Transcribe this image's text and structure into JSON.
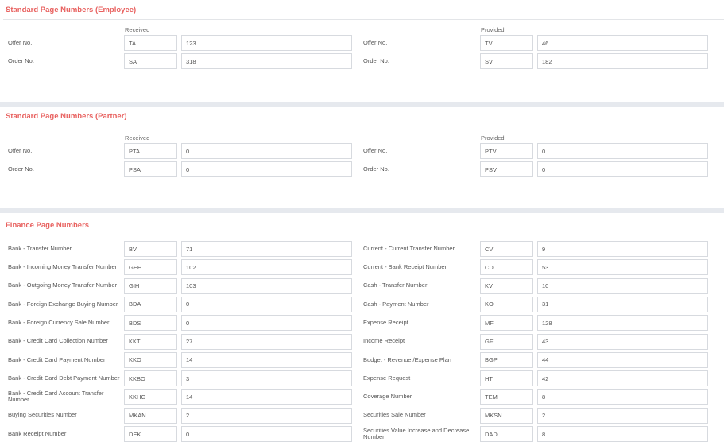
{
  "employee": {
    "title": "Standard Page Numbers (Employee)",
    "received_header": "Received",
    "provided_header": "Provided",
    "rows": [
      {
        "left_label": "Offer No.",
        "left_code": "TA",
        "left_value": "123",
        "right_label": "Offer No.",
        "right_code": "TV",
        "right_value": "46"
      },
      {
        "left_label": "Order No.",
        "left_code": "SA",
        "left_value": "318",
        "right_label": "Order No.",
        "right_code": "SV",
        "right_value": "182"
      }
    ]
  },
  "partner": {
    "title": "Standard Page Numbers (Partner)",
    "received_header": "Received",
    "provided_header": "Provided",
    "rows": [
      {
        "left_label": "Offer No.",
        "left_code": "PTA",
        "left_value": "0",
        "right_label": "Offer No.",
        "right_code": "PTV",
        "right_value": "0"
      },
      {
        "left_label": "Order No.",
        "left_code": "PSA",
        "left_value": "0",
        "right_label": "Order No.",
        "right_code": "PSV",
        "right_value": "0"
      }
    ]
  },
  "finance": {
    "title": "Finance Page Numbers",
    "rows": [
      {
        "left_label": "Bank - Transfer Number",
        "left_code": "BV",
        "left_value": "71",
        "right_label": "Current - Current Transfer Number",
        "right_code": "CV",
        "right_value": "9"
      },
      {
        "left_label": "Bank - Incoming Money Transfer Number",
        "left_code": "GEH",
        "left_value": "102",
        "right_label": "Current - Bank Receipt Number",
        "right_code": "CD",
        "right_value": "53"
      },
      {
        "left_label": "Bank - Outgoing Money Transfer Number",
        "left_code": "GIH",
        "left_value": "103",
        "right_label": "Cash - Transfer Number",
        "right_code": "KV",
        "right_value": "10"
      },
      {
        "left_label": "Bank - Foreign Exchange Buying Number",
        "left_code": "BDA",
        "left_value": "0",
        "right_label": "Cash - Payment Number",
        "right_code": "KO",
        "right_value": "31"
      },
      {
        "left_label": "Bank - Foreign Currency Sale Number",
        "left_code": "BDS",
        "left_value": "0",
        "right_label": "Expense Receipt",
        "right_code": "MF",
        "right_value": "128"
      },
      {
        "left_label": "Bank - Credit Card Collection Number",
        "left_code": "KKT",
        "left_value": "27",
        "right_label": "Income Receipt",
        "right_code": "GF",
        "right_value": "43"
      },
      {
        "left_label": "Bank - Credit Card Payment Number",
        "left_code": "KKO",
        "left_value": "14",
        "right_label": "Budget - Revenue /Expense Plan",
        "right_code": "BGP",
        "right_value": "44"
      },
      {
        "left_label": "Bank - Credit Card Debt Payment Number",
        "left_code": "KKBO",
        "left_value": "3",
        "right_label": "Expense Request",
        "right_code": "HT",
        "right_value": "42"
      },
      {
        "left_label": "Bank - Credit Card Account Transfer Number",
        "left_code": "KKHG",
        "left_value": "14",
        "right_label": "Coverage Number",
        "right_code": "TEM",
        "right_value": "8"
      },
      {
        "left_label": "Buying Securities Number",
        "left_code": "MKAN",
        "left_value": "2",
        "right_label": "Securities Sale Number",
        "right_code": "MKSN",
        "right_value": "2"
      },
      {
        "left_label": "Bank Receipt Number",
        "left_code": "DEK",
        "left_value": "0",
        "right_label": "Securities Value Increase and Decrease Number",
        "right_code": "DAD",
        "right_value": "8"
      }
    ]
  }
}
